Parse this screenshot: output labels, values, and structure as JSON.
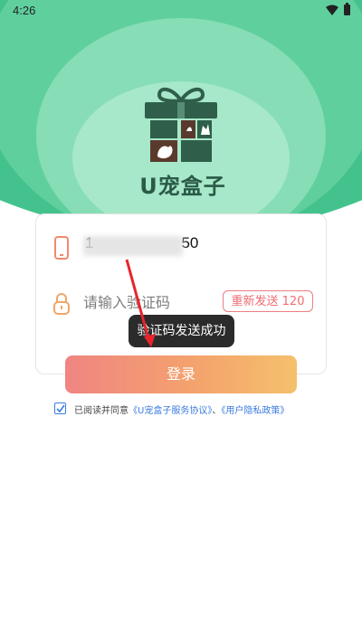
{
  "status_bar": {
    "time": "4:26"
  },
  "brand": {
    "name": "U宠盒子"
  },
  "form": {
    "phone_value": "1",
    "phone_value_tail": "50",
    "code_placeholder": "请输入验证码",
    "resend_label": "重新发送 120"
  },
  "toast": {
    "message": "验证码发送成功"
  },
  "login": {
    "label": "登录"
  },
  "agreement": {
    "prefix": "已阅读并同意",
    "service_link": "《U宠盒子服务协议》",
    "separator": "、",
    "privacy_link": "《用户隐私政策》",
    "checked": true
  },
  "colors": {
    "accent_green": "#43c28e",
    "logo_green": "#2f5f4a",
    "logo_brown": "#5a3a2c",
    "button_gradient_start": "#ef8582",
    "button_gradient_end": "#f5c06c",
    "link_blue": "#3c7be0",
    "resend_red": "#ef6b72"
  }
}
